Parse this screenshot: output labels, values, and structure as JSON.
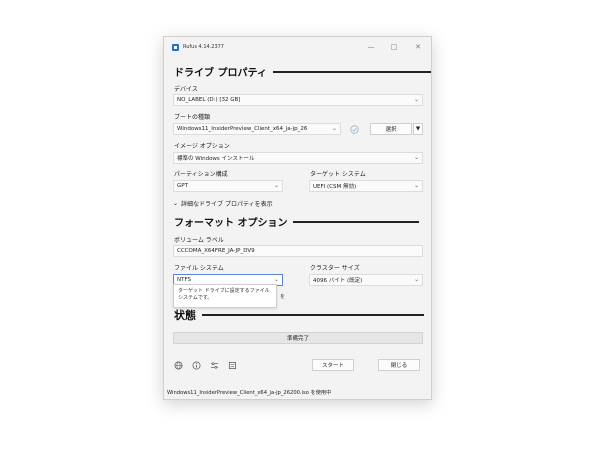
{
  "window": {
    "title": "Rufus 4.14.2377"
  },
  "drive_properties": {
    "heading": "ドライブ プロパティ",
    "device_label": "デバイス",
    "device_value": "NO_LABEL (D:) [32 GB]",
    "boot_label": "ブートの種類",
    "boot_value": "Windows11_InsiderPreview_Client_x64_ja-jp_26",
    "select_button": "選択",
    "image_option_label": "イメージ オプション",
    "image_option_value": "標準の Windows インストール",
    "partition_label": "パーティション構成",
    "partition_value": "GPT",
    "target_label": "ターゲット システム",
    "target_value": "UEFI (CSM 無効)",
    "advanced_toggle": "詳細なドライブ プロパティを表示"
  },
  "format_options": {
    "heading": "フォーマット オプション",
    "volume_label": "ボリューム ラベル",
    "volume_value": "CCCOMA_X64FRE_JA-JP_DV9",
    "fs_label": "ファイル システム",
    "fs_value": "NTFS",
    "cluster_label": "クラスター サイズ",
    "cluster_value": "4096 バイト (既定)",
    "tooltip": "ターゲット ドライブに設定するファイル システムです。"
  },
  "status": {
    "heading": "状態",
    "progress_text": "準備完了"
  },
  "actions": {
    "start": "スタート",
    "close": "閉じる"
  },
  "statusbar": {
    "text": "Windows11_InsiderPreview_Client_x64_ja-jp_26200.iso を使用中"
  },
  "colors": {
    "accent": "#2a6bd6",
    "focus": "#5a86d6"
  }
}
